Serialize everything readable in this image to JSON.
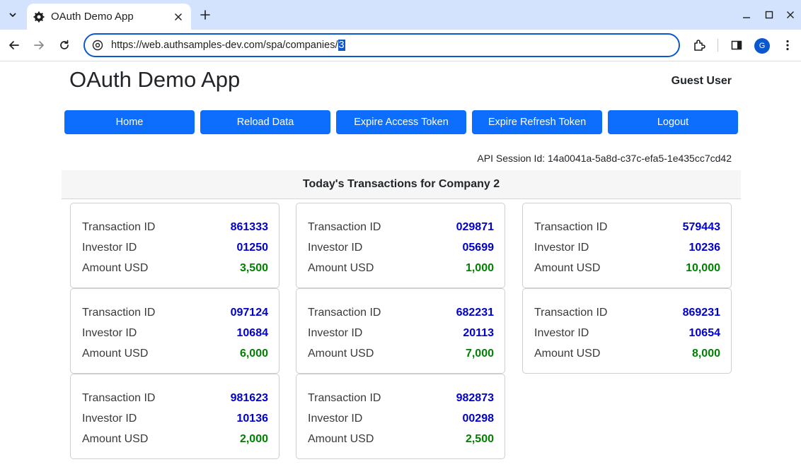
{
  "browser": {
    "tab_title": "OAuth Demo App",
    "url_main": "https://web.authsamples-dev.com/spa/companies/",
    "url_selected": "3",
    "profile_initial": "G"
  },
  "header": {
    "app_title": "OAuth Demo App",
    "user_name": "Guest User"
  },
  "nav": {
    "home": "Home",
    "reload": "Reload Data",
    "expire_access": "Expire Access Token",
    "expire_refresh": "Expire Refresh Token",
    "logout": "Logout"
  },
  "session": {
    "text": "API Session Id: 14a0041a-5a8d-c37c-efa5-1e435cc7cd42"
  },
  "transactions": {
    "title": "Today's Transactions for Company 2",
    "labels": {
      "transaction_id": "Transaction ID",
      "investor_id": "Investor ID",
      "amount": "Amount USD"
    },
    "items": [
      {
        "transaction_id": "861333",
        "investor_id": "01250",
        "amount": "3,500"
      },
      {
        "transaction_id": "029871",
        "investor_id": "05699",
        "amount": "1,000"
      },
      {
        "transaction_id": "579443",
        "investor_id": "10236",
        "amount": "10,000"
      },
      {
        "transaction_id": "097124",
        "investor_id": "10684",
        "amount": "6,000"
      },
      {
        "transaction_id": "682231",
        "investor_id": "20113",
        "amount": "7,000"
      },
      {
        "transaction_id": "869231",
        "investor_id": "10654",
        "amount": "8,000"
      },
      {
        "transaction_id": "981623",
        "investor_id": "10136",
        "amount": "2,000"
      },
      {
        "transaction_id": "982873",
        "investor_id": "00298",
        "amount": "2,500"
      }
    ]
  },
  "colors": {
    "primary_button": "#0d6efd",
    "id_value": "#0000cc",
    "amount_value": "#008000",
    "tabstrip": "#d3e3fd"
  }
}
